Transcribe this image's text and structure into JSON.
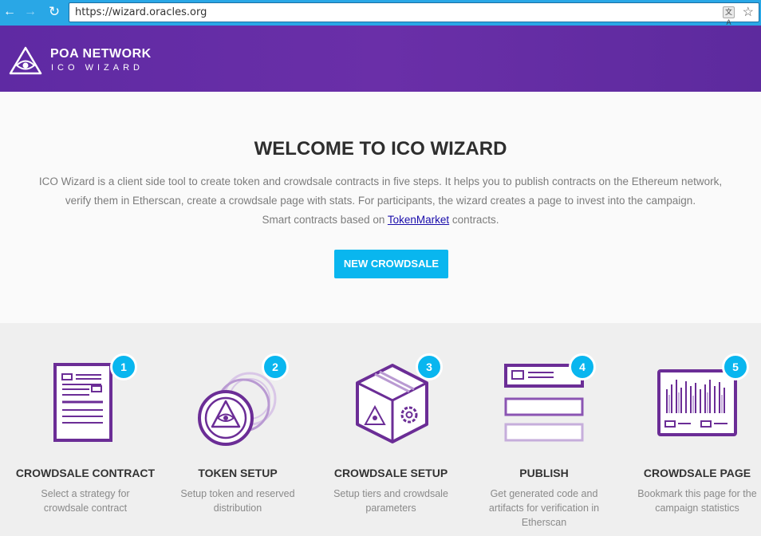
{
  "browser": {
    "url": "https://wizard.oracles.org",
    "back": "←",
    "forward": "→",
    "reload": "↻",
    "translate": "文A",
    "star": "☆"
  },
  "header": {
    "brand": "POA NETWORK",
    "subtitle": "ICO WIZARD"
  },
  "hero": {
    "title": "WELCOME TO ICO WIZARD",
    "desc_line1": "ICO Wizard is a client side tool to create token and crowdsale contracts in five steps. It helps you to publish contracts on the Ethereum network,",
    "desc_line2": "verify them in Etherscan, create a crowdsale page with stats. For participants, the wizard creates a page to invest into the campaign.",
    "desc_line3_prefix": "Smart contracts based on ",
    "desc_line3_link": "TokenMarket",
    "desc_line3_suffix": " contracts.",
    "cta": "NEW CROWDSALE"
  },
  "colors": {
    "accent": "#09b6ef",
    "purple": "#6a2fa8",
    "icon_purple": "#6b2d96"
  },
  "steps": [
    {
      "number": "1",
      "title": "CROWDSALE CONTRACT",
      "desc": "Select a strategy for crowdsale contract",
      "icon": "contract-document-icon"
    },
    {
      "number": "2",
      "title": "TOKEN SETUP",
      "desc": "Setup token and reserved distribution",
      "icon": "token-coins-icon"
    },
    {
      "number": "3",
      "title": "CROWDSALE SETUP",
      "desc": "Setup tiers and crowdsale parameters",
      "icon": "crowdsale-box-icon"
    },
    {
      "number": "4",
      "title": "PUBLISH",
      "desc": "Get generated code and artifacts for verification in Etherscan",
      "icon": "publish-forms-icon"
    },
    {
      "number": "5",
      "title": "CROWDSALE PAGE",
      "desc": "Bookmark this page for the campaign statistics",
      "icon": "crowdsale-page-chart-icon"
    }
  ]
}
